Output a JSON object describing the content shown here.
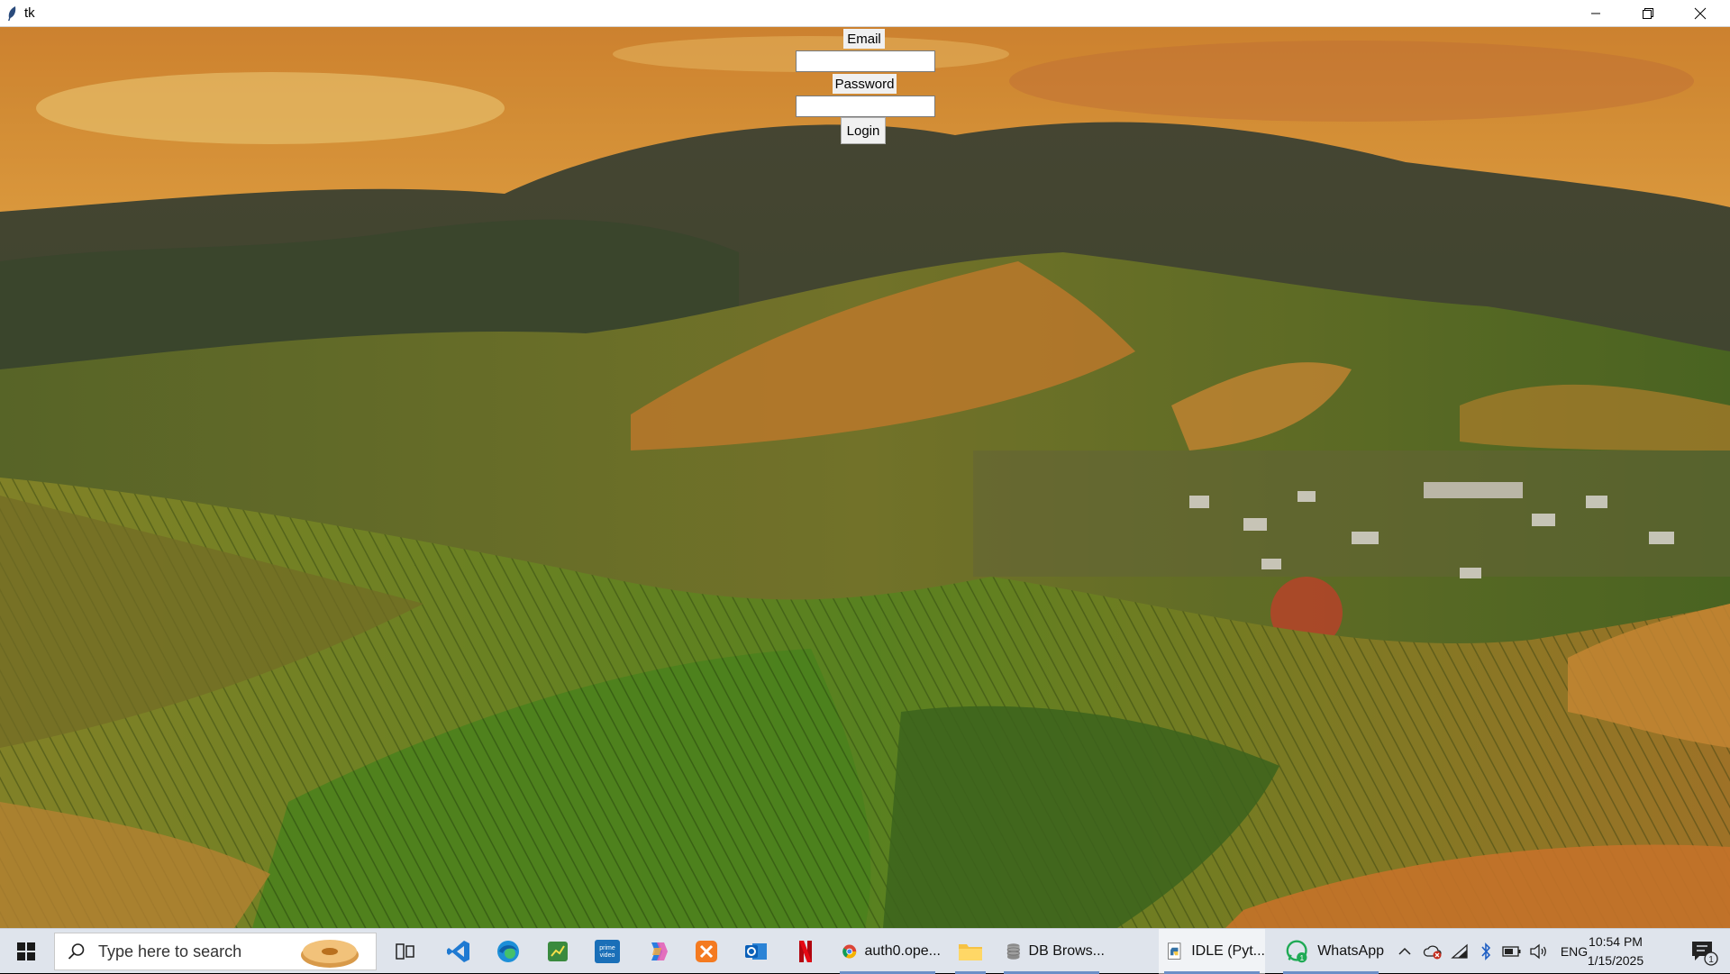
{
  "window": {
    "title": "tk"
  },
  "login_form": {
    "email_label": "Email",
    "email_value": "",
    "password_label": "Password",
    "password_value": "",
    "login_button": "Login"
  },
  "taskbar": {
    "search_placeholder": "Type here to search",
    "pinned": [
      "task-view-icon",
      "vscode-icon",
      "edge-icon",
      "sheets-icon",
      "prime-video-icon",
      "copilot-icon",
      "xampp-icon",
      "outlook-icon",
      "netflix-icon"
    ],
    "apps": [
      {
        "label": "auth0.ope...",
        "icon": "chrome-icon"
      },
      {
        "label": "",
        "icon": "file-explorer-icon"
      },
      {
        "label": "DB Brows...",
        "icon": "db-browser-icon"
      },
      {
        "label": "IDLE (Pyt...",
        "icon": "python-idle-icon"
      },
      {
        "label": "WhatsApp",
        "icon": "whatsapp-icon",
        "badge": "1"
      }
    ],
    "tray": {
      "language": "ENG",
      "time": "10:54 PM",
      "date": "1/15/2025",
      "notification_count": "1"
    }
  },
  "colors": {
    "accent": "#6b8fc7",
    "sky": "#f2b24a",
    "taskbar": "#dfe4ec"
  }
}
